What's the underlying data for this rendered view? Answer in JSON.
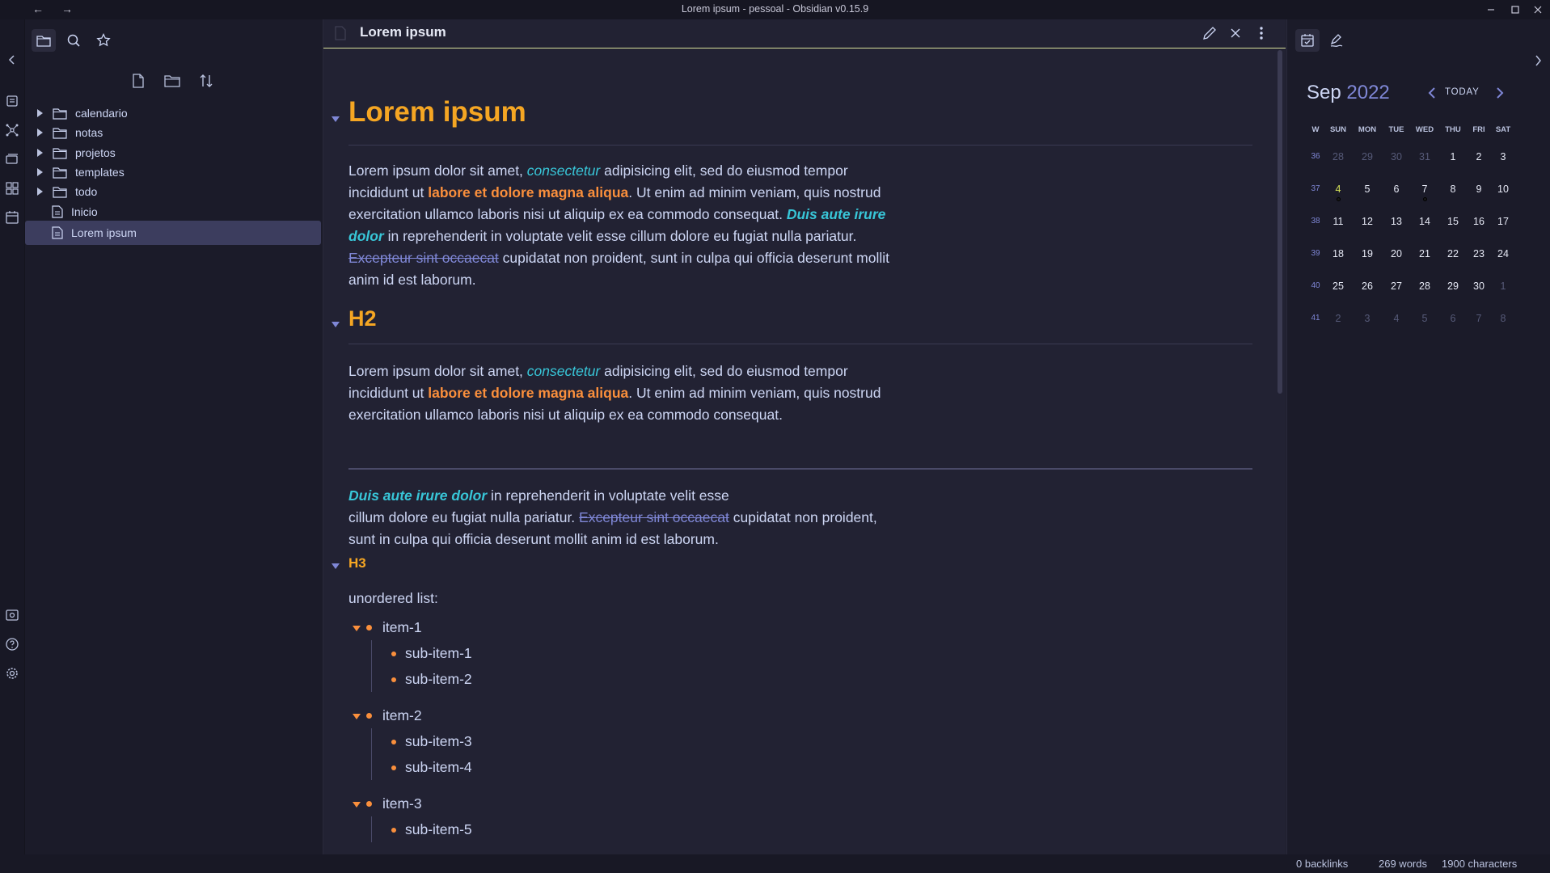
{
  "window": {
    "title": "Lorem ipsum - pessoal - Obsidian v0.15.9",
    "back": "←",
    "forward": "→"
  },
  "file_explorer": {
    "items": [
      {
        "type": "folder",
        "label": "calendario"
      },
      {
        "type": "folder",
        "label": "notas"
      },
      {
        "type": "folder",
        "label": "projetos"
      },
      {
        "type": "folder",
        "label": "templates"
      },
      {
        "type": "folder",
        "label": "todo"
      },
      {
        "type": "file",
        "label": "Inicio"
      },
      {
        "type": "file",
        "label": "Lorem ipsum",
        "selected": true
      }
    ]
  },
  "editor": {
    "tab_title": "Lorem ipsum",
    "h1": "Lorem ipsum",
    "p1": {
      "t1": "Lorem ipsum dolor sit amet, ",
      "italic1": "consectetur",
      "t2": " adipisicing elit, sed do eiusmod tempor incididunt ut ",
      "bold1": "labore et dolore magna aliqua",
      "t3": ". Ut enim ad minim veniam, quis nostrud exercitation ullamco laboris nisi ut aliquip ex ea commodo consequat. ",
      "bolditalic1": "Duis aute irure dolor",
      "t4": " in reprehenderit in voluptate velit esse cillum dolore eu fugiat nulla pariatur. ",
      "strike1": "Excepteur sint occaecat",
      "t5": " cupidatat non proident, sunt in culpa qui officia deserunt mollit anim id est laborum."
    },
    "h2": "H2",
    "p2": {
      "t1": "Lorem ipsum dolor sit amet, ",
      "italic1": "consectetur",
      "t2": " adipisicing elit, sed do eiusmod tempor incididunt ut ",
      "bold1": "labore et dolore magna aliqua",
      "t3": ". Ut enim ad minim veniam, quis nostrud exercitation ullamco laboris nisi ut aliquip ex ea commodo consequat."
    },
    "p3": {
      "bolditalic1": "Duis aute irure dolor",
      "t1": " in reprehenderit in voluptate velit esse",
      "t2": "cillum dolore eu fugiat nulla pariatur. ",
      "strike1": "Excepteur sint occaecat",
      "t3": " cupidatat non proident, sunt in culpa qui officia deserunt mollit anim id est laborum."
    },
    "h3": "H3",
    "list_intro": "unordered list:",
    "list": [
      {
        "label": "item-1",
        "children": [
          "sub-item-1",
          "sub-item-2"
        ]
      },
      {
        "label": "item-2",
        "children": [
          "sub-item-3",
          "sub-item-4"
        ]
      },
      {
        "label": "item-3",
        "children": [
          "sub-item-5"
        ]
      }
    ]
  },
  "calendar": {
    "month": "Sep",
    "year": "2022",
    "today_label": "TODAY",
    "week_header": "W",
    "days_of_week": [
      "SUN",
      "MON",
      "TUE",
      "WED",
      "THU",
      "FRI",
      "SAT"
    ],
    "weeks": [
      {
        "w": "36",
        "days": [
          "28",
          "29",
          "30",
          "31",
          "1",
          "2",
          "3"
        ]
      },
      {
        "w": "37",
        "days": [
          "4",
          "5",
          "6",
          "7",
          "8",
          "9",
          "10"
        ]
      },
      {
        "w": "38",
        "days": [
          "11",
          "12",
          "13",
          "14",
          "15",
          "16",
          "17"
        ]
      },
      {
        "w": "39",
        "days": [
          "18",
          "19",
          "20",
          "21",
          "22",
          "23",
          "24"
        ]
      },
      {
        "w": "40",
        "days": [
          "25",
          "26",
          "27",
          "28",
          "29",
          "30",
          "1"
        ]
      },
      {
        "w": "41",
        "days": [
          "2",
          "3",
          "4",
          "5",
          "6",
          "7",
          "8"
        ]
      }
    ],
    "current_day": "4"
  },
  "status_bar": {
    "backlinks": "0 backlinks",
    "words": "269 words",
    "characters": "1900 characters"
  },
  "colors": {
    "heading": "#f5a623",
    "bold": "#fa8f3c",
    "italic": "#38c6d8",
    "strike": "#7f87d6",
    "accent": "#7f87d6"
  }
}
